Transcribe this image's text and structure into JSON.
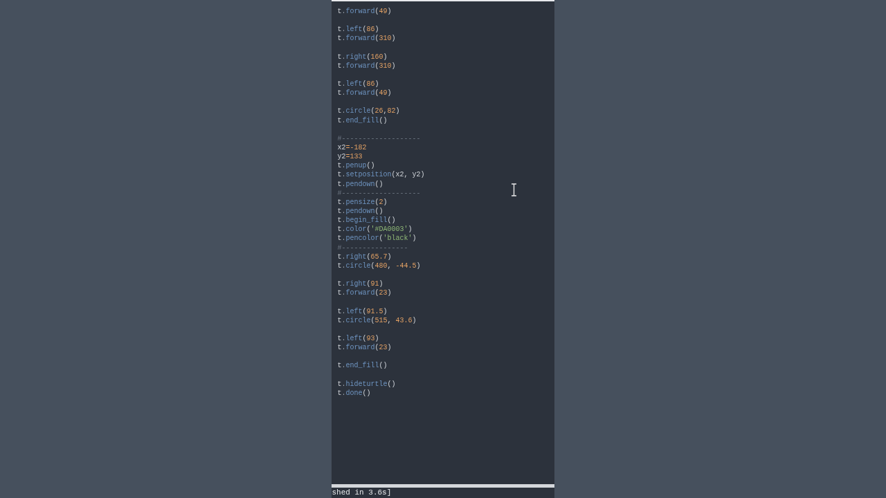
{
  "editor": {
    "blocks": [
      [
        "t.forward(49)"
      ],
      [
        "t.left(86)",
        "t.forward(310)"
      ],
      [
        "t.right(160)",
        "t.forward(310)"
      ],
      [
        "t.left(86)",
        "t.forward(49)"
      ],
      [
        "t.circle(26,82)",
        "t.end_fill()"
      ],
      [
        "#-------------------",
        "x2=-182",
        "y2=133",
        "t.penup()",
        "t.setposition(x2, y2)",
        "t.pendown()",
        "#-------------------",
        "t.pensize(2)",
        "t.pendown()",
        "t.begin_fill()",
        "t.color('#DA0003')",
        "t.pencolor('black')",
        "#----------------",
        "t.right(65.7)",
        "t.circle(480, -44.5)"
      ],
      [
        "t.right(91)",
        "t.forward(23)"
      ],
      [
        "t.left(91.5)",
        "t.circle(515, 43.6)"
      ],
      [
        "t.left(93)",
        "t.forward(23)"
      ],
      [
        "t.end_fill()"
      ],
      [
        "t.hideturtle()",
        "t.done()"
      ]
    ]
  },
  "status_bar": {
    "text": "shed in 3.6s]"
  }
}
